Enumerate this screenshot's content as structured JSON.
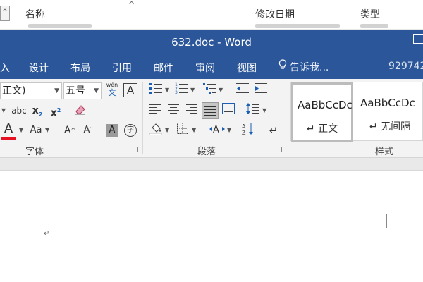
{
  "explorer": {
    "col_name": "名称",
    "col_modified": "修改日期",
    "col_type": "类型",
    "left_glyph": "^",
    "sort_glyph": "^"
  },
  "window": {
    "title": "632.doc - Word",
    "accent": "#2b579a"
  },
  "tabs": [
    "入",
    "设计",
    "布局",
    "引用",
    "邮件",
    "审阅",
    "视图"
  ],
  "tell_me": "告诉我...",
  "user_id": "929742",
  "font_group": {
    "font_name": "正文)",
    "font_size": "五号",
    "phonetic_top": "wén",
    "phonetic_bottom": "文",
    "label": "字体",
    "strike": "abc",
    "subscript": "x",
    "subscript_mark": "2",
    "superscript": "x",
    "superscript_mark": "2",
    "font_color_letter": "A",
    "case_letters": "Aa",
    "grow_letter": "A",
    "shrink_letter": "A",
    "shade_letter": "A",
    "border_letter": "A",
    "enclose_char": "字",
    "font_color": "#e81123"
  },
  "para_group": {
    "label": "段落",
    "bullets_line": "☰",
    "ab_line": "A↓"
  },
  "styles_group": {
    "label": "样式",
    "styles": [
      {
        "sample": "AaBbCcDc",
        "name": "↵ 正文"
      },
      {
        "sample": "AaBbCcDc",
        "name": "↵ 无间隔"
      }
    ]
  },
  "document": {
    "cursor_mark": "↵"
  }
}
